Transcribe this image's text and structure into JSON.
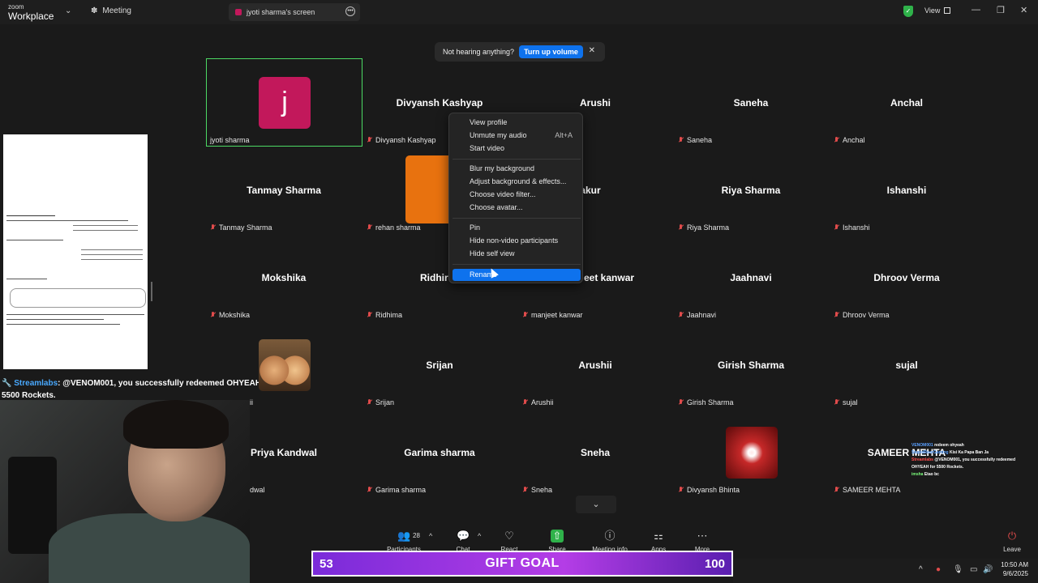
{
  "titlebar": {
    "brand_top": "zoom",
    "brand_bottom": "Workplace",
    "meeting_label": "Meeting",
    "screen_tab": "jyoti sharma's screen",
    "view_label": "View"
  },
  "banner": {
    "text": "Not hearing anything?",
    "button": "Turn up volume"
  },
  "tiles": [
    {
      "name": "",
      "label": "jyoti sharma"
    },
    {
      "name": "Divyansh Kashyap",
      "label": "Divyansh Kashyap"
    },
    {
      "name": "Arushi",
      "label": ""
    },
    {
      "name": "Saneha",
      "label": "Saneha"
    },
    {
      "name": "Anchal",
      "label": "Anchal"
    },
    {
      "name": "Tanmay Sharma",
      "label": "Tanmay Sharma"
    },
    {
      "name": "",
      "label": "rehan sharma"
    },
    {
      "name": "ish Thakur",
      "label": ""
    },
    {
      "name": "Riya Sharma",
      "label": "Riya Sharma"
    },
    {
      "name": "Ishanshi",
      "label": "Ishanshi"
    },
    {
      "name": "Mokshika",
      "label": "Mokshika"
    },
    {
      "name": "Ridhir",
      "label": "Ridhima"
    },
    {
      "name": "eet kanwar",
      "label": "manjeet kanwar"
    },
    {
      "name": "Jaahnavi",
      "label": "Jaahnavi"
    },
    {
      "name": "Dhroov Verma",
      "label": "Dhroov Verma"
    },
    {
      "name": "",
      "label": "ii"
    },
    {
      "name": "Srijan",
      "label": "Srijan"
    },
    {
      "name": "Arushii",
      "label": "Arushii"
    },
    {
      "name": "Girish Sharma",
      "label": "Girish Sharma"
    },
    {
      "name": "sujal",
      "label": "sujal"
    },
    {
      "name": "Priya Kandwal",
      "label": "dwal"
    },
    {
      "name": "Garima sharma",
      "label": "Garima sharma"
    },
    {
      "name": "Sneha",
      "label": "Sneha"
    },
    {
      "name": "",
      "label": "Divyansh Bhinta"
    },
    {
      "name": "SAMEER MEHTA",
      "label": "SAMEER MEHTA"
    }
  ],
  "avatar_letter": "j",
  "context_menu": {
    "items": [
      "View profile",
      "Unmute my audio",
      "Start video",
      "Blur my background",
      "Adjust background & effects...",
      "Choose video filter...",
      "Choose avatar...",
      "Pin",
      "Hide non-video participants",
      "Hide self view",
      "Rename"
    ],
    "unmute_shortcut": "Alt+A"
  },
  "stream": {
    "user": "Streamlabs",
    "message": ": @VENOM001, you successfully redeemed OHYEAH for 5500 Rockets."
  },
  "toolbar": {
    "participants": "Participants",
    "participants_count": "28",
    "chat": "Chat",
    "react": "React",
    "share": "Share",
    "meeting_info": "Meeting info",
    "apps": "Apps",
    "more": "More",
    "leave": "Leave"
  },
  "gift_goal": {
    "current": "53",
    "title": "GIFT GOAL",
    "target": "100"
  },
  "clock": {
    "time": "10:50 AM",
    "date": "9/6/2025"
  },
  "chat_overlay": {
    "l1_user": "VENOM001",
    "l1_text": "redeem ohyeah",
    "l2_user": "StupidRoarGaming",
    "l2_text": "Kisi Ka Papa Ban Ja",
    "l3_user": "Streamlabs",
    "l3_text": "@VENOM001, you successfully redeemed OHYEAH for 5500 Rockets.",
    "l4_user": "imsha",
    "l4_text": "Etao bc"
  },
  "colors": {
    "accent": "#0e72ed",
    "avatar": "#c2185b",
    "self_border": "#4cd964",
    "share": "#2fb24a"
  }
}
